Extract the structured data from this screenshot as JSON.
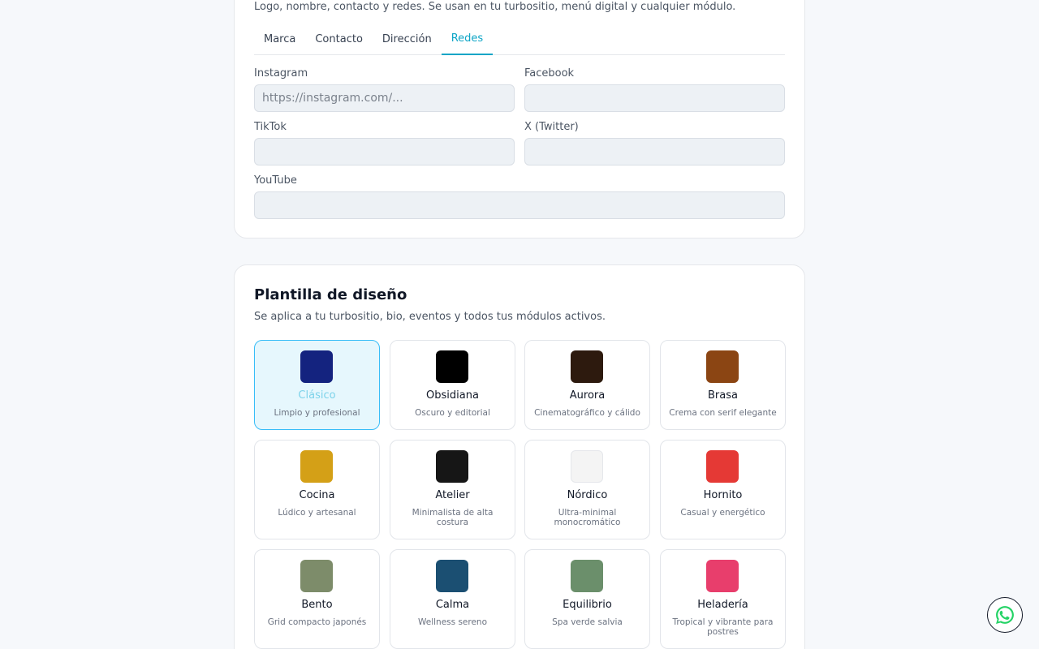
{
  "business": {
    "subtitle": "Logo, nombre, contacto y redes. Se usan en tu turbositio, menú digital y cualquier módulo.",
    "tabs": [
      {
        "label": "Marca",
        "active": false
      },
      {
        "label": "Contacto",
        "active": false
      },
      {
        "label": "Dirección",
        "active": false
      },
      {
        "label": "Redes",
        "active": true
      }
    ],
    "fields": {
      "instagram": {
        "label": "Instagram",
        "value": "",
        "placeholder": "https://instagram.com/..."
      },
      "facebook": {
        "label": "Facebook",
        "value": "",
        "placeholder": ""
      },
      "tiktok": {
        "label": "TikTok",
        "value": "",
        "placeholder": ""
      },
      "twitter": {
        "label": "X (Twitter)",
        "value": "",
        "placeholder": ""
      },
      "youtube": {
        "label": "YouTube",
        "value": "",
        "placeholder": ""
      }
    }
  },
  "templates": {
    "title": "Plantilla de diseño",
    "subtitle": "Se aplica a tu turbositio, bio, eventos y todos tus módulos activos.",
    "items": [
      {
        "name": "Clásico",
        "desc": "Limpio y profesional",
        "color": "#14237f",
        "selected": true
      },
      {
        "name": "Obsidiana",
        "desc": "Oscuro y editorial",
        "color": "#000000",
        "selected": false
      },
      {
        "name": "Aurora",
        "desc": "Cinematográfico y cálido",
        "color": "#2d1a0e",
        "selected": false
      },
      {
        "name": "Brasa",
        "desc": "Crema con serif elegante",
        "color": "#8b4513",
        "selected": false
      },
      {
        "name": "Cocina",
        "desc": "Lúdico y artesanal",
        "color": "#d4a017",
        "selected": false
      },
      {
        "name": "Atelier",
        "desc": "Minimalista de alta costura",
        "color": "#161616",
        "selected": false
      },
      {
        "name": "Nórdico",
        "desc": "Ultra-minimal monocromático",
        "color": "#f4f4f4",
        "selected": false
      },
      {
        "name": "Hornito",
        "desc": "Casual y energético",
        "color": "#e53935",
        "selected": false
      },
      {
        "name": "Bento",
        "desc": "Grid compacto japonés",
        "color": "#7d8c6a",
        "selected": false
      },
      {
        "name": "Calma",
        "desc": "Wellness sereno",
        "color": "#1b4f72",
        "selected": false
      },
      {
        "name": "Equilibrio",
        "desc": "Spa verde salvia",
        "color": "#6b8f6b",
        "selected": false
      },
      {
        "name": "Heladería",
        "desc": "Tropical y vibrante para postres",
        "color": "#e83e6c",
        "selected": false
      }
    ]
  },
  "whatsapp": {
    "icon": "whatsapp-icon"
  }
}
